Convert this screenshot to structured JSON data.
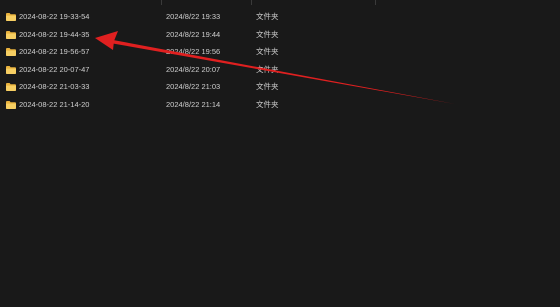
{
  "rows": [
    {
      "name": "2024-08-22 19-33-54",
      "date": "2024/8/22 19:33",
      "type": "文件夹"
    },
    {
      "name": "2024-08-22 19-44-35",
      "date": "2024/8/22 19:44",
      "type": "文件夹"
    },
    {
      "name": "2024-08-22 19-56-57",
      "date": "2024/8/22 19:56",
      "type": "文件夹"
    },
    {
      "name": "2024-08-22 20-07-47",
      "date": "2024/8/22 20:07",
      "type": "文件夹"
    },
    {
      "name": "2024-08-22 21-03-33",
      "date": "2024/8/22 21:03",
      "type": "文件夹"
    },
    {
      "name": "2024-08-22 21-14-20",
      "date": "2024/8/22 21:14",
      "type": "文件夹"
    }
  ],
  "icons": {
    "row_icon": "folder-icon",
    "annotation": "red-arrow-icon"
  },
  "colors": {
    "background": "#191919",
    "text": "#cfcfcf",
    "folder": "#f2c14e",
    "arrow": "#e02020"
  }
}
